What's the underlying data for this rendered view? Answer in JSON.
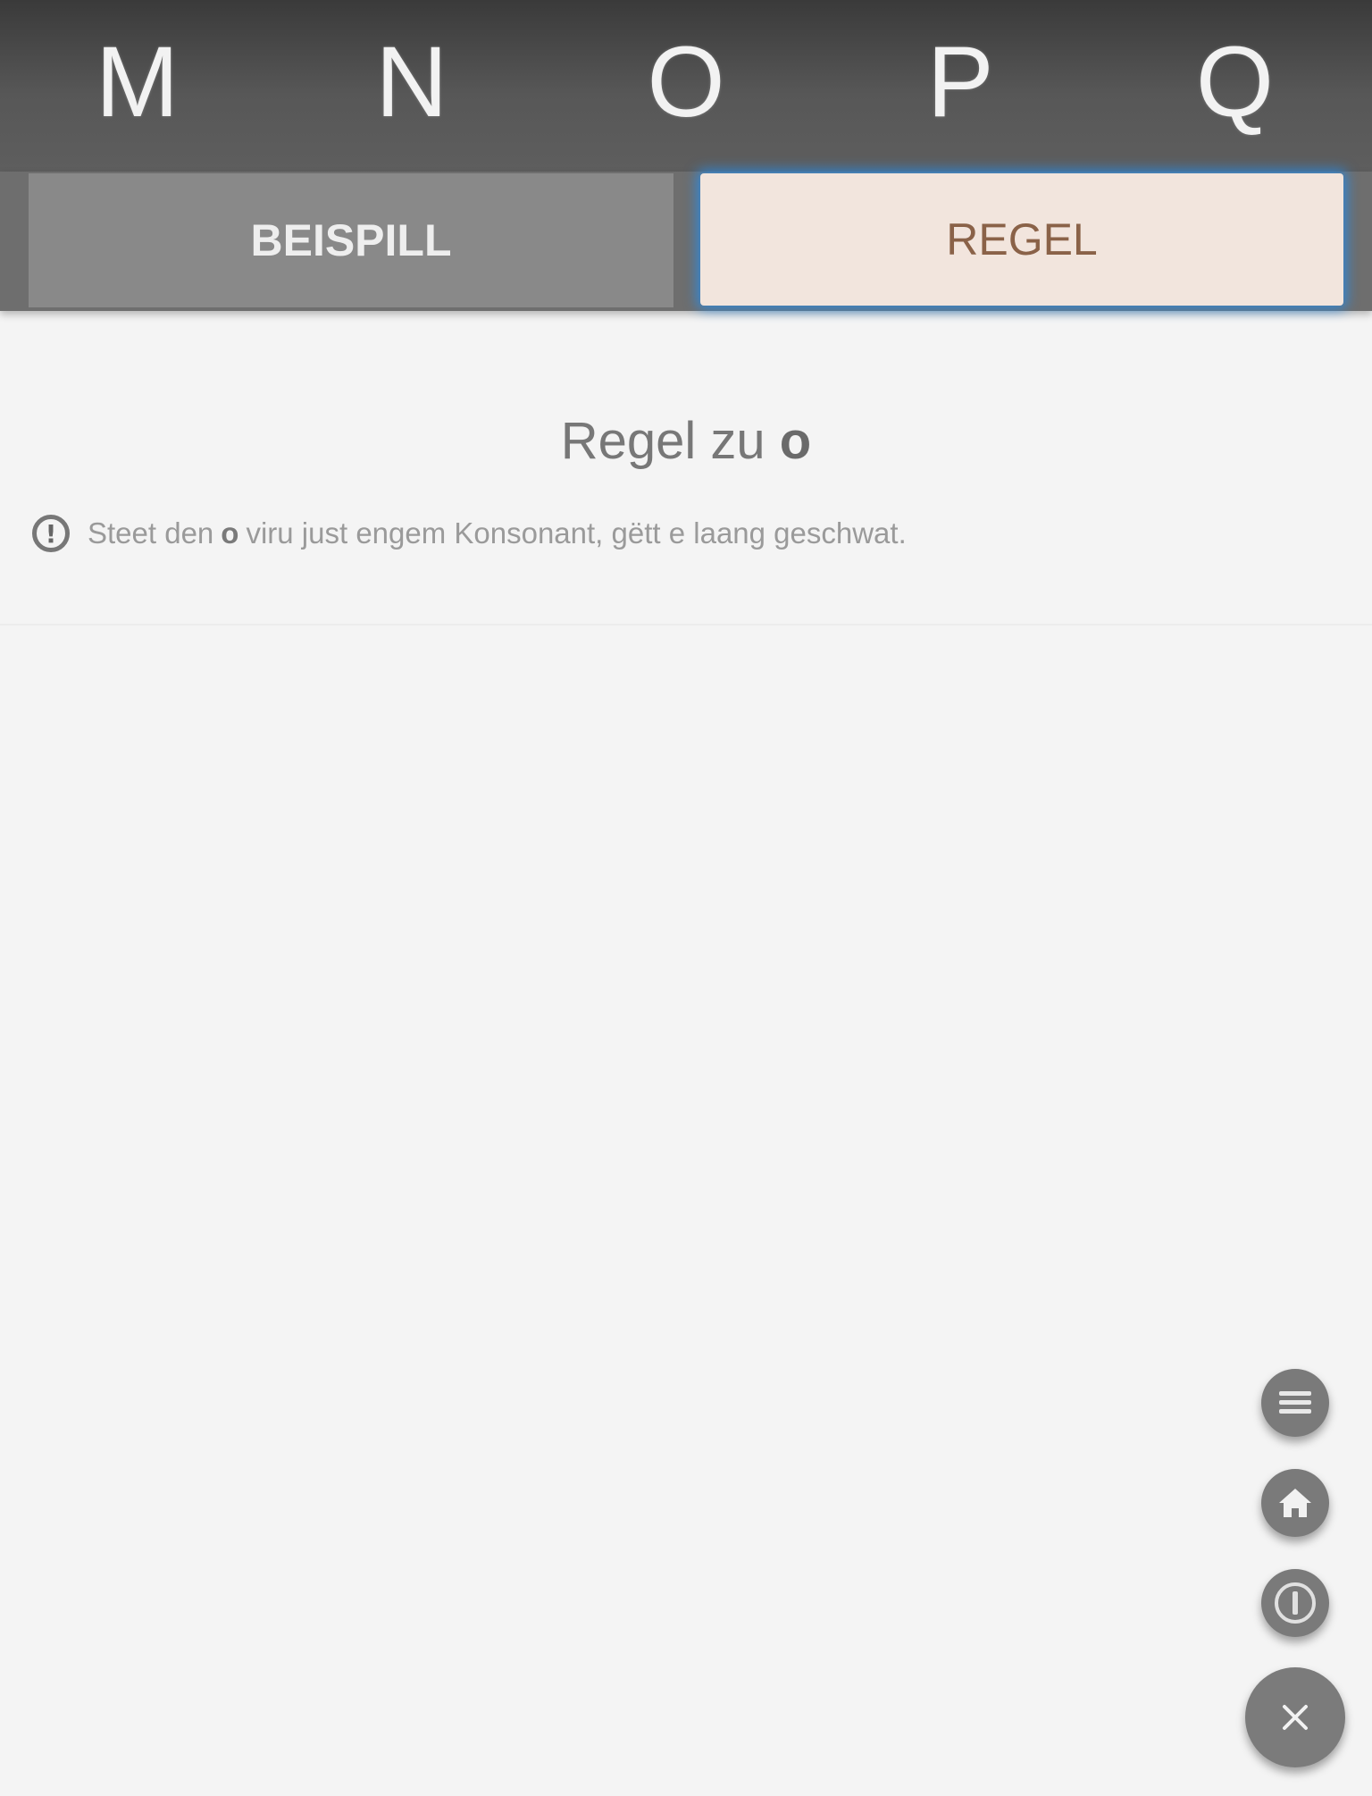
{
  "letters": [
    "M",
    "N",
    "O",
    "P",
    "Q"
  ],
  "tabs": {
    "example_label": "BEISPILL",
    "rule_label": "REGEL",
    "active": "rule"
  },
  "rule": {
    "title_prefix": "Regel zu",
    "title_letter": "o",
    "text_before": "Steet den",
    "text_letter": "o",
    "text_after": "viru just engem Konsonant, gëtt e laang geschwat."
  },
  "icons": {
    "info": "info-icon",
    "menu": "menu-icon",
    "home": "home-icon",
    "about": "info-circle-icon",
    "close": "close-icon"
  },
  "colors": {
    "header_bg": "#4a4a4a",
    "tab_inactive": "#898989",
    "tab_active_bg": "#f2e5dd",
    "tab_active_text": "#8a6248",
    "accent_glow": "#288ce6",
    "fab_bg": "#7a7a7a"
  }
}
